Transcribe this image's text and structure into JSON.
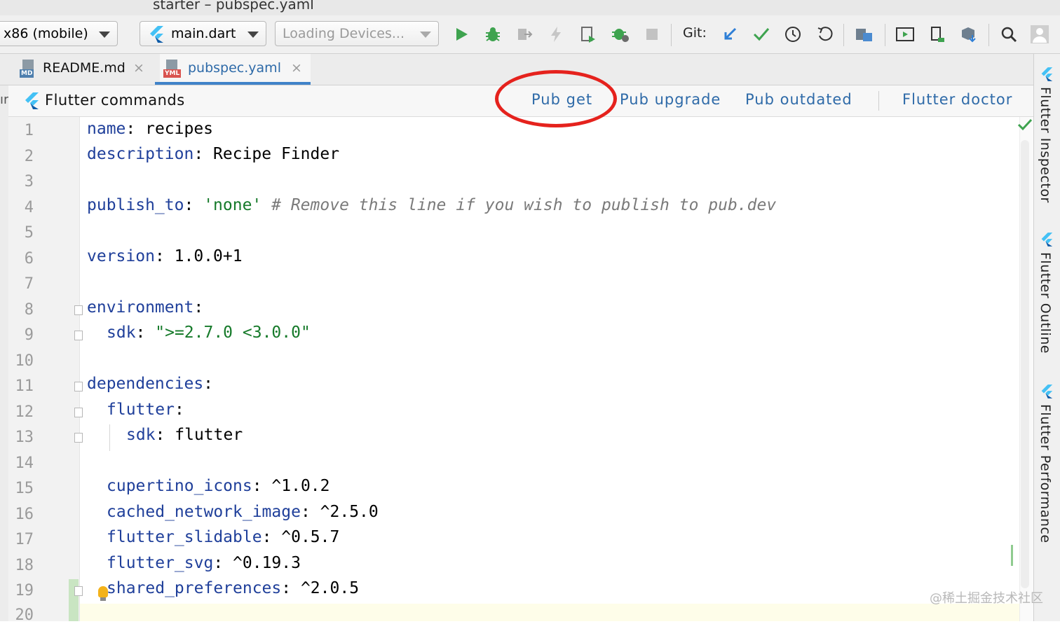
{
  "window": {
    "title": "starter – pubspec.yaml"
  },
  "toolbar": {
    "device_combo": "x86 (mobile)",
    "config_combo": "main.dart",
    "devices_combo": "Loading Devices...",
    "git_label": "Git:",
    "icons": [
      "run-icon",
      "debug-icon",
      "attach-debugger-icon",
      "hot-reload-icon",
      "run-with-coverage-icon",
      "profile-icon",
      "stop-icon",
      "git-update-icon",
      "git-commit-icon",
      "git-history-icon",
      "git-rollback-icon",
      "project-structure-icon",
      "android-avd-icon",
      "sdk-manager-icon",
      "device-file-explorer-icon",
      "search-icon",
      "account-icon"
    ]
  },
  "tabs": [
    {
      "label": "README.md",
      "icon_tag": "MD",
      "active": false
    },
    {
      "label": "pubspec.yaml",
      "icon_tag": "YML",
      "active": true
    }
  ],
  "flutter_commands": {
    "title": "Flutter commands",
    "links": [
      "Pub get",
      "Pub upgrade",
      "Pub outdated",
      "Flutter doctor"
    ]
  },
  "left_fragment": "ır",
  "editor": {
    "line_numbers": [
      "1",
      "2",
      "3",
      "4",
      "5",
      "6",
      "7",
      "8",
      "9",
      "10",
      "11",
      "12",
      "13",
      "14",
      "15",
      "16",
      "17",
      "18",
      "19",
      "20"
    ],
    "lines": {
      "l1_key": "name",
      "l1_val": "recipes",
      "l2_key": "description",
      "l2_val": "Recipe Finder",
      "l4_key": "publish_to",
      "l4_val": "'none'",
      "l4_comment": "# Remove this line if you wish to publish to pub.dev",
      "l6_key": "version",
      "l6_val": "1.0.0+1",
      "l8_key": "environment",
      "l9_key": "sdk",
      "l9_val": "\">=2.7.0 <3.0.0\"",
      "l11_key": "dependencies",
      "l12_key": "flutter",
      "l13_key": "sdk",
      "l13_val": "flutter",
      "l15_key": "cupertino_icons",
      "l15_val": "^1.0.2",
      "l16_key": "cached_network_image",
      "l16_val": "^2.5.0",
      "l17_key": "flutter_slidable",
      "l17_val": "^0.5.7",
      "l18_key": "flutter_svg",
      "l18_val": "^0.19.3",
      "l19_key": "shared_preferences",
      "l19_val": "^2.0.5"
    }
  },
  "right_tools": [
    "Flutter Inspector",
    "Flutter Outline",
    "Flutter Performance"
  ],
  "watermark": "@稀土掘金技术社区",
  "colors": {
    "accent": "#4083c9",
    "link": "#2e6aa8",
    "highlight_oval": "#e5221d",
    "yaml_key": "#1f3f9a",
    "yaml_string": "#167a2a"
  }
}
